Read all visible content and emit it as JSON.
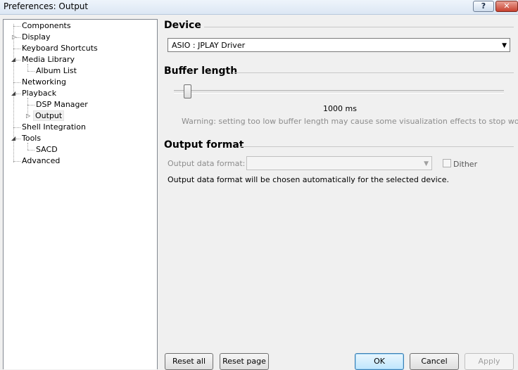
{
  "window": {
    "title": "Preferences: Output",
    "help_label": "?",
    "close_label": "✕"
  },
  "tree": {
    "items": [
      {
        "label": "Components"
      },
      {
        "label": "Display"
      },
      {
        "label": "Keyboard Shortcuts"
      },
      {
        "label": "Media Library"
      },
      {
        "label": "Album List"
      },
      {
        "label": "Networking"
      },
      {
        "label": "Playback"
      },
      {
        "label": "DSP Manager"
      },
      {
        "label": "Output",
        "selected": true
      },
      {
        "label": "Shell Integration"
      },
      {
        "label": "Tools"
      },
      {
        "label": "SACD"
      },
      {
        "label": "Advanced"
      }
    ]
  },
  "device": {
    "title": "Device",
    "selected": "ASIO : JPLAY Driver"
  },
  "buffer": {
    "title": "Buffer length",
    "value_label": "1000 ms",
    "warning": "Warning: setting too low buffer length may cause some visualization effects to stop working."
  },
  "output_format": {
    "title": "Output format",
    "format_label": "Output data format:",
    "format_value": "",
    "dither_label": "Dither",
    "dither_checked": false,
    "note": "Output data format will be chosen automatically for the selected device."
  },
  "buttons": {
    "reset_all": "Reset all",
    "reset_page": "Reset page",
    "ok": "OK",
    "cancel": "Cancel",
    "apply": "Apply"
  }
}
